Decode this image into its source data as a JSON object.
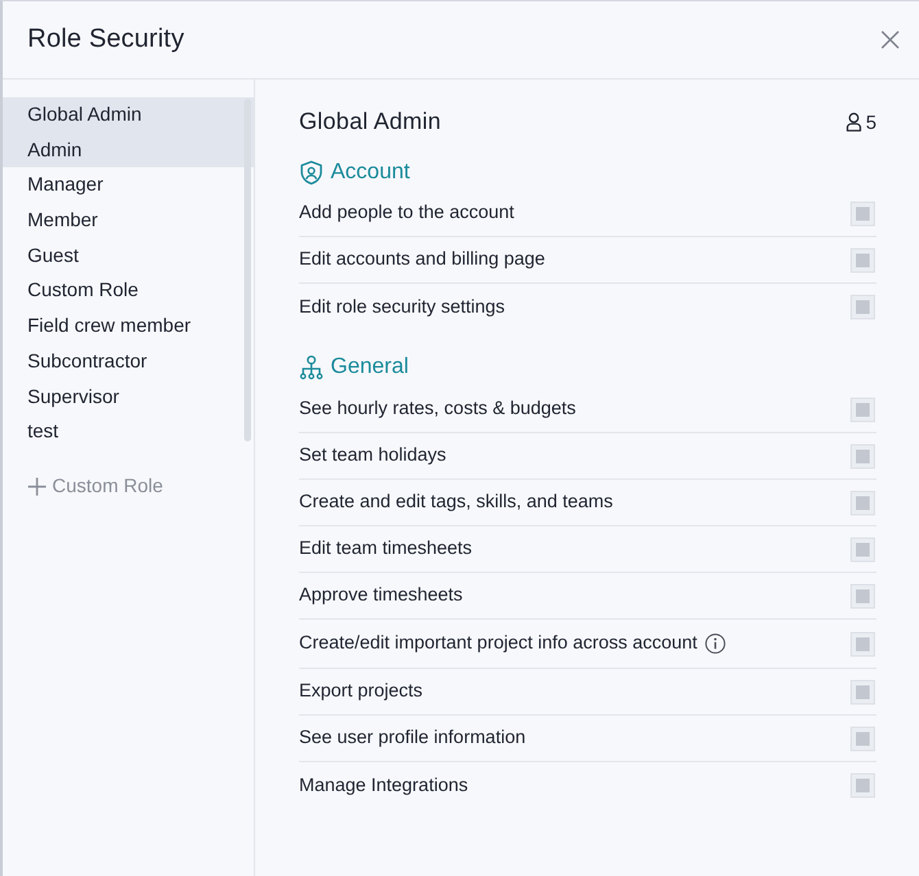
{
  "dialog": {
    "title": "Role Security"
  },
  "roles": [
    {
      "label": "Global Admin",
      "selected": true,
      "hovered": false
    },
    {
      "label": "Admin",
      "selected": false,
      "hovered": true
    },
    {
      "label": "Manager",
      "selected": false,
      "hovered": false
    },
    {
      "label": "Member",
      "selected": false,
      "hovered": false
    },
    {
      "label": "Guest",
      "selected": false,
      "hovered": false
    },
    {
      "label": "Custom Role",
      "selected": false,
      "hovered": false
    },
    {
      "label": "Field crew member",
      "selected": false,
      "hovered": false
    },
    {
      "label": "Subcontractor",
      "selected": false,
      "hovered": false
    },
    {
      "label": "Supervisor",
      "selected": false,
      "hovered": false
    },
    {
      "label": "test",
      "selected": false,
      "hovered": false
    }
  ],
  "add_role": {
    "label": "Custom Role"
  },
  "detail": {
    "title": "Global Admin",
    "member_count": "5"
  },
  "sections": [
    {
      "kind": "account",
      "title": "Account",
      "permissions": [
        {
          "label": "Add people to the account",
          "info": false,
          "checked": true,
          "disabled": true
        },
        {
          "label": "Edit accounts and billing page",
          "info": false,
          "checked": true,
          "disabled": true
        },
        {
          "label": "Edit role security settings",
          "info": false,
          "checked": true,
          "disabled": true
        }
      ]
    },
    {
      "kind": "general",
      "title": "General",
      "permissions": [
        {
          "label": "See hourly rates, costs & budgets",
          "info": false,
          "checked": true,
          "disabled": true
        },
        {
          "label": "Set team holidays",
          "info": false,
          "checked": true,
          "disabled": true
        },
        {
          "label": "Create and edit tags, skills, and teams",
          "info": false,
          "checked": true,
          "disabled": true
        },
        {
          "label": "Edit team timesheets",
          "info": false,
          "checked": true,
          "disabled": true
        },
        {
          "label": "Approve timesheets",
          "info": false,
          "checked": true,
          "disabled": true
        },
        {
          "label": "Create/edit important project info across account",
          "info": true,
          "checked": true,
          "disabled": true
        },
        {
          "label": "Export projects",
          "info": false,
          "checked": true,
          "disabled": true
        },
        {
          "label": "See user profile information",
          "info": false,
          "checked": true,
          "disabled": true
        },
        {
          "label": "Manage Integrations",
          "info": false,
          "checked": true,
          "disabled": true
        }
      ]
    }
  ]
}
